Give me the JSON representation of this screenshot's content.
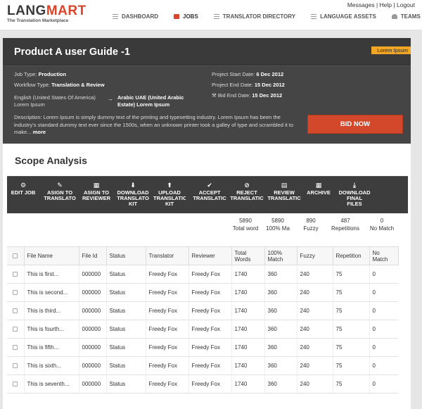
{
  "brand": {
    "name_part1": "LANG",
    "name_part2": "MART",
    "tagline": "The Translation Marketplace"
  },
  "utility": {
    "messages": "Messages",
    "help": "Help",
    "logout": "Logout",
    "sep": "|"
  },
  "nav": [
    {
      "label": "DASHBOARD",
      "icon": "dashboard-icon",
      "active": false
    },
    {
      "label": "JOBS",
      "icon": "jobs-icon",
      "active": true
    },
    {
      "label": "TRANSLATOR DIRECTORY",
      "icon": "directory-icon",
      "active": false
    },
    {
      "label": "LANGUAGE ASSETS",
      "icon": "assets-icon",
      "active": false
    },
    {
      "label": "TEAMS",
      "icon": "teams-icon",
      "active": false
    }
  ],
  "job": {
    "title": "Product A user Guide -1",
    "ribbon": "Lorem Ipsum",
    "job_type_label": "Job Type:",
    "job_type": "Production",
    "workflow_label": "Workflow Type:",
    "workflow": "Translation & Review",
    "source_lang": "English (United States Of America) Lorem Ipsum",
    "arrow": "→",
    "target_lang": "Arabic UAE (United Arabic Estate) Lorem Ipsum",
    "start_label": "Project Start Date:",
    "start": "6 Dec 2012",
    "end_label": "Project End Date:",
    "end": "15 Dec 2012",
    "bid_end_label": "Bid End Date:",
    "bid_end": "15 Dec 2012",
    "description_label": "Description:",
    "description": "Lorem Ipsum is simply dummy text of the printing and typesetting industry. Lorem Ipsum has been the industry's standard dummy text ever since the 1500s, when an unknown printer took a galley of type and scrambled it to make...",
    "more": "more",
    "bid_button": "BID NOW"
  },
  "scope": {
    "title": "Scope Analysis",
    "actions": [
      {
        "label": "EDIT JOB",
        "icon": "gear-icon"
      },
      {
        "label": "ASIGN TO\nTRANSLATO",
        "icon": "assign-translator-icon"
      },
      {
        "label": "ASIGN TO\nREVIEWER",
        "icon": "assign-reviewer-icon"
      },
      {
        "label": "DOWNLOAD\nTRANSLATO\nKIT",
        "icon": "download-icon"
      },
      {
        "label": "UPLOAD\nTRANSLATIC\nKIT",
        "icon": "upload-icon"
      },
      {
        "label": "ACCEPT\nTRANSLATIC",
        "icon": "accept-icon"
      },
      {
        "label": "REJECT\nTRANSLATIC",
        "icon": "reject-icon"
      },
      {
        "label": "REVIEW\nTRANSLATIC",
        "icon": "review-icon"
      },
      {
        "label": "ARCHIVE",
        "icon": "archive-icon"
      },
      {
        "label": "DOWNLOAD\nFINAL\nFILES",
        "icon": "download-files-icon"
      }
    ],
    "summary": [
      {
        "value": "5890",
        "label": "Total word"
      },
      {
        "value": "5890",
        "label": "100% Ma"
      },
      {
        "value": "890",
        "label": "Fuzzy"
      },
      {
        "value": "487",
        "label": "Repetitions"
      },
      {
        "value": "0",
        "label": "No Match"
      }
    ],
    "columns": [
      "File Name",
      "File Id",
      "Status",
      "Translator",
      "Reviewer",
      "Total Words",
      "100% Match",
      "Fuzzy",
      "Repetition",
      "No Match"
    ],
    "rows": [
      [
        "This is first...",
        "000000",
        "Status",
        "Freedy Fox",
        "Freedy Fox",
        "1740",
        "360",
        "240",
        "75",
        "0"
      ],
      [
        "This is second...",
        "000000",
        "Status",
        "Freedy Fox",
        "Freedy Fox",
        "1740",
        "360",
        "240",
        "75",
        "0"
      ],
      [
        "This is third...",
        "000000",
        "Status",
        "Freedy Fox",
        "Freedy Fox",
        "1740",
        "360",
        "240",
        "75",
        "0"
      ],
      [
        "This is fourth...",
        "000000",
        "Status",
        "Freedy Fox",
        "Freedy Fox",
        "1740",
        "360",
        "240",
        "75",
        "0"
      ],
      [
        "This is fifth...",
        "000000",
        "Status",
        "Freedy Fox",
        "Freedy Fox",
        "1740",
        "360",
        "240",
        "75",
        "0"
      ],
      [
        "This is sixth...",
        "000000",
        "Status",
        "Freedy Fox",
        "Freedy Fox",
        "1740",
        "360",
        "240",
        "75",
        "0"
      ],
      [
        "This is seventh...",
        "000000",
        "Status",
        "Freedy Fox",
        "Freedy Fox",
        "1740",
        "360",
        "240",
        "75",
        "0"
      ]
    ]
  },
  "colors": {
    "accent": "#d9452b",
    "ribbon": "#f2a623",
    "card": "#454545",
    "toolbar": "#3d3d3d"
  }
}
